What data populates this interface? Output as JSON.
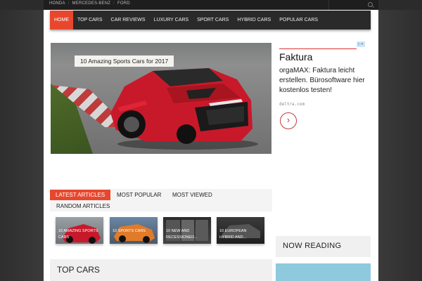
{
  "topbar": {
    "links": [
      "HONDA",
      "MERCEDES-BENZ",
      "FORD"
    ],
    "separator": "/"
  },
  "nav": {
    "items": [
      "HOME",
      "TOP CARS",
      "CAR REVIEWS",
      "LUXURY CARS",
      "SPORT CARS",
      "HYBRID CARS",
      "POPULAR CARS"
    ],
    "active_index": 0
  },
  "hero": {
    "caption": "10 Amazing Sports Cars for 2017"
  },
  "ad": {
    "brand": "Faktura",
    "copy": "orgaMAX: Faktura leicht erstellen. Bürosoftware hier kostenlos testen!",
    "domain": "deltra.com",
    "arrow": "›"
  },
  "tabs": {
    "items": [
      "LATEST ARTICLES",
      "MOST POPULAR",
      "MOST VIEWED",
      "RANDOM ARTICLES"
    ],
    "active_index": 0
  },
  "thumbnails": [
    {
      "caption": "10 AMAZING SPORTS CARS"
    },
    {
      "caption": "10 SPORTS CARS"
    },
    {
      "caption": "10 NEW AND RECESSIONED..."
    },
    {
      "caption": "10 EUROPEAN HYBRID AND..."
    }
  ],
  "sidebar": {
    "now_reading": "NOW READING"
  },
  "sections": {
    "top_cars": "TOP CARS"
  },
  "colors": {
    "accent": "#e8472d",
    "nav_bg": "#2a2a2a",
    "topbar_bg": "#1e1e1e"
  }
}
